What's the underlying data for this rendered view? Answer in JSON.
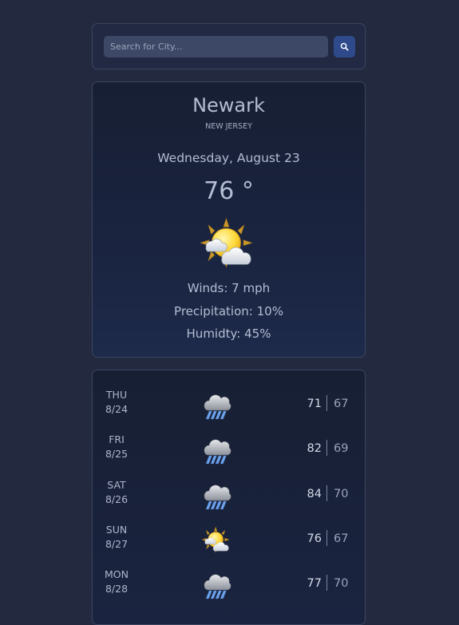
{
  "search": {
    "placeholder": "Search for City...",
    "button_icon": "search-icon"
  },
  "current": {
    "city": "Newark",
    "state": "NEW JERSEY",
    "date": "Wednesday, August 23",
    "temperature": "76 °",
    "icon": "partly-sunny-icon",
    "winds": "Winds: 7 mph",
    "precipitation": "Precipitation: 10%",
    "humidity": "Humidty: 45%"
  },
  "forecast": [
    {
      "day": "THU",
      "date": "8/24",
      "icon": "rain-cloud-icon",
      "high": "71",
      "low": "67"
    },
    {
      "day": "FRI",
      "date": "8/25",
      "icon": "rain-cloud-icon",
      "high": "82",
      "low": "69"
    },
    {
      "day": "SAT",
      "date": "8/26",
      "icon": "rain-cloud-icon",
      "high": "84",
      "low": "70"
    },
    {
      "day": "SUN",
      "date": "8/27",
      "icon": "partly-sunny-icon",
      "high": "76",
      "low": "67"
    },
    {
      "day": "MON",
      "date": "8/28",
      "icon": "rain-cloud-icon",
      "high": "77",
      "low": "70"
    }
  ],
  "colors": {
    "background": "#232a40",
    "card": "#1a2440",
    "accent": "#2f4a8a",
    "border": "#3c4560"
  }
}
